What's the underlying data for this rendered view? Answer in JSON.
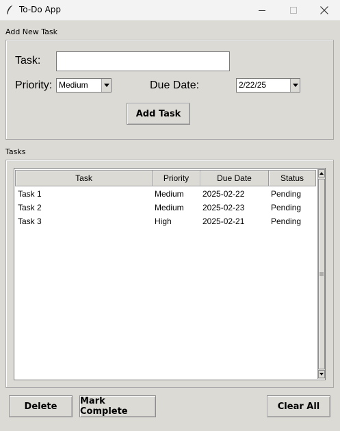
{
  "window": {
    "title": "To-Do App"
  },
  "add_group": {
    "label": "Add New Task",
    "task_label": "Task:",
    "task_value": "",
    "priority_label": "Priority:",
    "priority_value": "Medium",
    "due_label": "Due Date:",
    "due_value": "2/22/25",
    "add_button": "Add Task"
  },
  "tasks_group": {
    "label": "Tasks",
    "columns": [
      "Task",
      "Priority",
      "Due Date",
      "Status"
    ],
    "rows": [
      [
        "Task 1",
        "Medium",
        "2025-02-22",
        "Pending"
      ],
      [
        "Task 2",
        "Medium",
        "2025-02-23",
        "Pending"
      ],
      [
        "Task 3",
        "High",
        "2025-02-21",
        "Pending"
      ]
    ]
  },
  "buttons": {
    "delete": "Delete",
    "mark_complete": "Mark Complete",
    "clear_all": "Clear All"
  },
  "icons": [
    "feather-icon",
    "minimize-icon",
    "maximize-icon",
    "close-icon",
    "chevron-down-icon",
    "scroll-up-icon",
    "scroll-down-icon",
    "grip-icon"
  ]
}
